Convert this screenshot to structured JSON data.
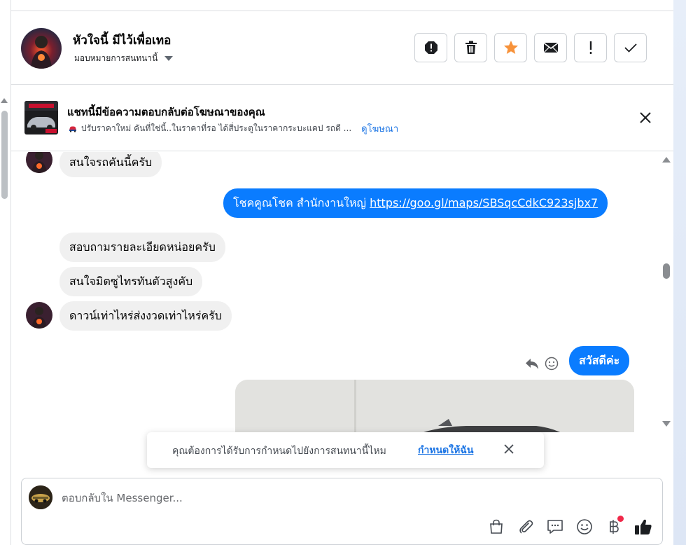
{
  "header": {
    "name": "หัวใจนี้ มีไว้เพื่อเทอ",
    "assign_label": "มอบหมายการสนทนานี้",
    "actions": [
      "report-icon",
      "trash-icon",
      "star-icon",
      "mail-icon",
      "exclamation-icon",
      "check-icon"
    ]
  },
  "ad_banner": {
    "title": "แชทนี้มีข้อความตอบกลับต่อโฆษณาของคุณ",
    "snippet": "ปรับราคาใหม่ คันที่ใช่นี้..ในราคาที่รอ ได้สี่ประตูในราคากระบะแคป รถดี ...",
    "link": "ดูโฆษณา"
  },
  "messages": [
    {
      "from": "them",
      "text": "สนใจรถคันนี้ครับ"
    },
    {
      "from": "me",
      "text": "โชคคูณโชค สำนักงานใหญ่",
      "link": "https://goo.gl/maps/SBSqcCdkC923sjbx7"
    },
    {
      "from": "them",
      "text": "สอบถามรายละเอียดหน่อยครับ"
    },
    {
      "from": "them",
      "text": "สนใจมิตซูไทรทันตัวสูงคับ"
    },
    {
      "from": "them",
      "text": "ดาวน์เท่าไหร่ส่งงวดเท่าไหร่ครับ"
    },
    {
      "from": "me",
      "text": "สวัสดีค่ะ"
    }
  ],
  "toast": {
    "text": "คุณต้องการได้รับการกำหนดไปยังการสนทนานี้ไหม",
    "link": "กำหนดให้ฉัน"
  },
  "composer": {
    "placeholder": "ตอบกลับใน Messenger...",
    "tools": [
      "bag-icon",
      "paperclip-icon",
      "saved-reply-icon",
      "emoji-icon",
      "baht-icon",
      "thumbs-up-icon"
    ]
  },
  "colors": {
    "accent": "#0a7cff",
    "link": "#1b74e4",
    "incoming_bubble": "#f0f0f0",
    "star": "#f7923a",
    "notification_dot": "#f02849"
  }
}
